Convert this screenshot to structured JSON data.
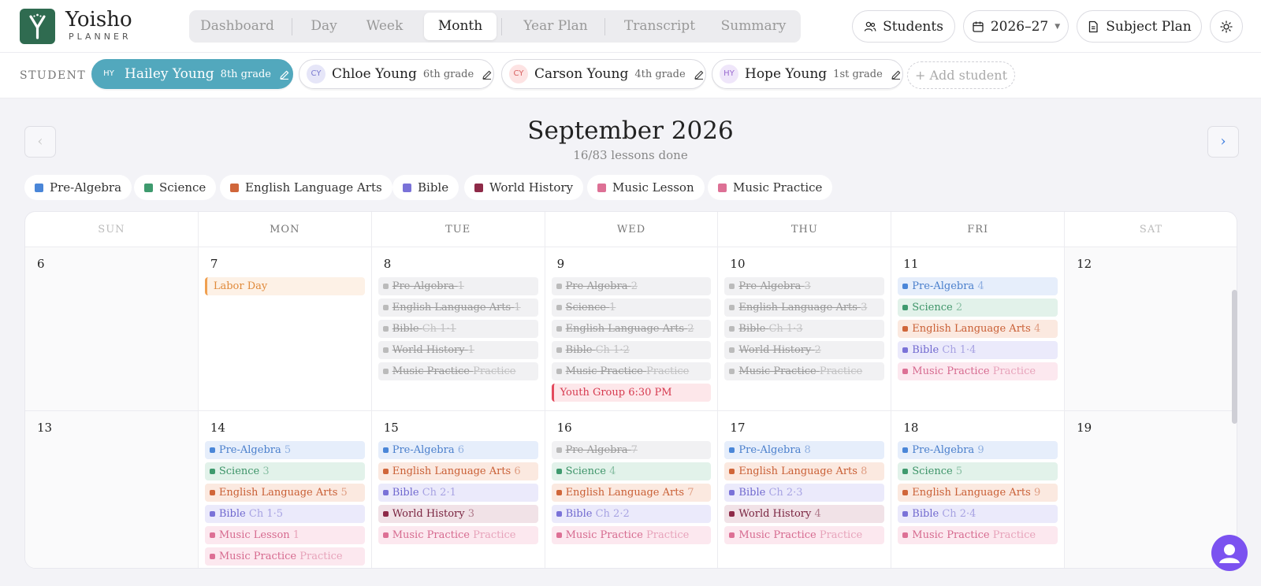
{
  "brand": {
    "name": "Yoisho",
    "sub": "PLANNER"
  },
  "nav": [
    {
      "label": "Dashboard"
    },
    {
      "label": "Day"
    },
    {
      "label": "Week"
    },
    {
      "label": "Month"
    },
    {
      "label": "Year Plan"
    },
    {
      "label": "Transcript"
    },
    {
      "label": "Summary"
    }
  ],
  "nav_active": "Month",
  "header_buttons": {
    "students": "Students",
    "year": "2026–27",
    "subject_plan": "Subject Plan"
  },
  "student_label": "STUDENT",
  "students": [
    {
      "initials": "HY",
      "name": "Hailey Young",
      "grade": "8th grade",
      "avatar_bg": "#52a8bd",
      "avatar_fg": "#ffffff"
    },
    {
      "initials": "CY",
      "name": "Chloe Young",
      "grade": "6th grade",
      "avatar_bg": "#e6e6f8",
      "avatar_fg": "#7a7ad0"
    },
    {
      "initials": "CY",
      "name": "Carson Young",
      "grade": "4th grade",
      "avatar_bg": "#fde3e3",
      "avatar_fg": "#d86060"
    },
    {
      "initials": "HY",
      "name": "Hope Young",
      "grade": "1st grade",
      "avatar_bg": "#efe6fa",
      "avatar_fg": "#9a6ad0"
    }
  ],
  "add_student": "+ Add student",
  "month": {
    "title": "September 2026",
    "subtitle": "16/83 lessons done",
    "prev": "‹",
    "next": "›"
  },
  "legend": [
    {
      "label": "Pre-Algebra",
      "color": "#4a86d8"
    },
    {
      "label": "Science",
      "color": "#3e9a6e"
    },
    {
      "label": "English Language Arts",
      "color": "#d0663a"
    },
    {
      "label": "Bible",
      "color": "#7a72d8"
    },
    {
      "label": "World History",
      "color": "#8e2a48"
    },
    {
      "label": "Music Lesson",
      "color": "#dd7095"
    },
    {
      "label": "Music Practice",
      "color": "#dd7095"
    }
  ],
  "subjects": {
    "Pre-Algebra": {
      "color": "#4a86d8",
      "bg": "#e6eefb",
      "text": "#4a7fcc"
    },
    "Science": {
      "color": "#3e9a6e",
      "bg": "#e2f2ea",
      "text": "#3d9468"
    },
    "English Language Arts": {
      "color": "#d0663a",
      "bg": "#fbe9e0",
      "text": "#c95f35"
    },
    "Bible": {
      "color": "#7a72d8",
      "bg": "#ebeafb",
      "text": "#7068cf"
    },
    "World History": {
      "color": "#8e2a48",
      "bg": "#f1e2e7",
      "text": "#7a2440"
    },
    "Music Lesson": {
      "color": "#dd7095",
      "bg": "#fce8ef",
      "text": "#d66a8f"
    },
    "Music Practice": {
      "color": "#dd7095",
      "bg": "#fce8ef",
      "text": "#d66a8f"
    }
  },
  "days_of_week": [
    "SUN",
    "MON",
    "TUE",
    "WED",
    "THU",
    "FRI",
    "SAT"
  ],
  "weeks": [
    [
      {
        "day": "6",
        "events": []
      },
      {
        "day": "7",
        "events": [
          {
            "kind": "holiday",
            "label": "Labor Day"
          }
        ]
      },
      {
        "day": "8",
        "events": [
          {
            "s": "Pre-Algebra",
            "label": "Pre-Algebra",
            "sfx": "1",
            "done": true
          },
          {
            "s": "English Language Arts",
            "label": "English Language Arts",
            "sfx": "1",
            "done": true
          },
          {
            "s": "Bible",
            "label": "Bible",
            "sfx": "Ch 1·1",
            "done": true
          },
          {
            "s": "World History",
            "label": "World History",
            "sfx": "1",
            "done": true
          },
          {
            "s": "Music Practice",
            "label": "Music Practice",
            "sfx": "Practice",
            "done": true
          }
        ]
      },
      {
        "day": "9",
        "events": [
          {
            "s": "Pre-Algebra",
            "label": "Pre-Algebra",
            "sfx": "2",
            "done": true
          },
          {
            "s": "Science",
            "label": "Science",
            "sfx": "1",
            "done": true
          },
          {
            "s": "English Language Arts",
            "label": "English Language Arts",
            "sfx": "2",
            "done": true
          },
          {
            "s": "Bible",
            "label": "Bible",
            "sfx": "Ch 1·2",
            "done": true
          },
          {
            "s": "Music Practice",
            "label": "Music Practice",
            "sfx": "Practice",
            "done": true
          },
          {
            "kind": "youth",
            "label": "Youth Group 6:30 PM"
          }
        ]
      },
      {
        "day": "10",
        "events": [
          {
            "s": "Pre-Algebra",
            "label": "Pre-Algebra",
            "sfx": "3",
            "done": true
          },
          {
            "s": "English Language Arts",
            "label": "English Language Arts",
            "sfx": "3",
            "done": true
          },
          {
            "s": "Bible",
            "label": "Bible",
            "sfx": "Ch 1·3",
            "done": true
          },
          {
            "s": "World History",
            "label": "World History",
            "sfx": "2",
            "done": true
          },
          {
            "s": "Music Practice",
            "label": "Music Practice",
            "sfx": "Practice",
            "done": true
          }
        ]
      },
      {
        "day": "11",
        "events": [
          {
            "s": "Pre-Algebra",
            "label": "Pre-Algebra",
            "sfx": "4",
            "done": false
          },
          {
            "s": "Science",
            "label": "Science",
            "sfx": "2",
            "done": false
          },
          {
            "s": "English Language Arts",
            "label": "English Language Arts",
            "sfx": "4",
            "done": false
          },
          {
            "s": "Bible",
            "label": "Bible",
            "sfx": "Ch 1·4",
            "done": false
          },
          {
            "s": "Music Practice",
            "label": "Music Practice",
            "sfx": "Practice",
            "done": false
          }
        ]
      },
      {
        "day": "12",
        "events": []
      }
    ],
    [
      {
        "day": "13",
        "events": []
      },
      {
        "day": "14",
        "events": [
          {
            "s": "Pre-Algebra",
            "label": "Pre-Algebra",
            "sfx": "5",
            "done": false
          },
          {
            "s": "Science",
            "label": "Science",
            "sfx": "3",
            "done": false
          },
          {
            "s": "English Language Arts",
            "label": "English Language Arts",
            "sfx": "5",
            "done": false
          },
          {
            "s": "Bible",
            "label": "Bible",
            "sfx": "Ch 1·5",
            "done": false
          },
          {
            "s": "Music Lesson",
            "label": "Music Lesson",
            "sfx": "1",
            "done": false
          },
          {
            "s": "Music Practice",
            "label": "Music Practice",
            "sfx": "Practice",
            "done": false
          }
        ]
      },
      {
        "day": "15",
        "events": [
          {
            "s": "Pre-Algebra",
            "label": "Pre-Algebra",
            "sfx": "6",
            "done": false
          },
          {
            "s": "English Language Arts",
            "label": "English Language Arts",
            "sfx": "6",
            "done": false
          },
          {
            "s": "Bible",
            "label": "Bible",
            "sfx": "Ch 2·1",
            "done": false
          },
          {
            "s": "World History",
            "label": "World History",
            "sfx": "3",
            "done": false
          },
          {
            "s": "Music Practice",
            "label": "Music Practice",
            "sfx": "Practice",
            "done": false
          }
        ]
      },
      {
        "day": "16",
        "events": [
          {
            "s": "Pre-Algebra",
            "label": "Pre-Algebra",
            "sfx": "7",
            "done": true
          },
          {
            "s": "Science",
            "label": "Science",
            "sfx": "4",
            "done": false
          },
          {
            "s": "English Language Arts",
            "label": "English Language Arts",
            "sfx": "7",
            "done": false
          },
          {
            "s": "Bible",
            "label": "Bible",
            "sfx": "Ch 2·2",
            "done": false
          },
          {
            "s": "Music Practice",
            "label": "Music Practice",
            "sfx": "Practice",
            "done": false
          }
        ]
      },
      {
        "day": "17",
        "events": [
          {
            "s": "Pre-Algebra",
            "label": "Pre-Algebra",
            "sfx": "8",
            "done": false
          },
          {
            "s": "English Language Arts",
            "label": "English Language Arts",
            "sfx": "8",
            "done": false
          },
          {
            "s": "Bible",
            "label": "Bible",
            "sfx": "Ch 2·3",
            "done": false
          },
          {
            "s": "World History",
            "label": "World History",
            "sfx": "4",
            "done": false
          },
          {
            "s": "Music Practice",
            "label": "Music Practice",
            "sfx": "Practice",
            "done": false
          }
        ]
      },
      {
        "day": "18",
        "events": [
          {
            "s": "Pre-Algebra",
            "label": "Pre-Algebra",
            "sfx": "9",
            "done": false
          },
          {
            "s": "Science",
            "label": "Science",
            "sfx": "5",
            "done": false
          },
          {
            "s": "English Language Arts",
            "label": "English Language Arts",
            "sfx": "9",
            "done": false
          },
          {
            "s": "Bible",
            "label": "Bible",
            "sfx": "Ch 2·4",
            "done": false
          },
          {
            "s": "Music Practice",
            "label": "Music Practice",
            "sfx": "Practice",
            "done": false
          }
        ]
      },
      {
        "day": "19",
        "events": []
      }
    ]
  ],
  "icons": {
    "students": "users-icon",
    "year": "calendar-icon",
    "subject_plan": "document-icon",
    "theme": "sun-icon",
    "edit": "pencil-icon",
    "chat": "chat-user-icon",
    "logo": "logo-icon"
  }
}
